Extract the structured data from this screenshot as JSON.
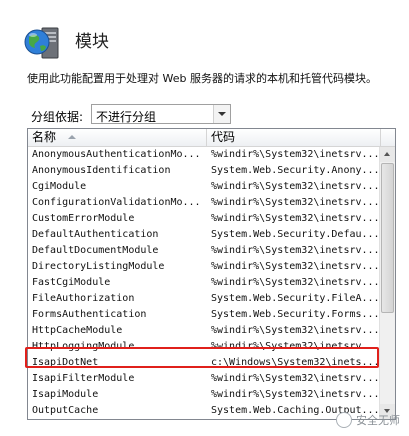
{
  "header": {
    "title": "模块",
    "icon": "globe-server-icon"
  },
  "description": "使用此功能配置用于处理对 Web 服务器的请求的本机和托管代码模块。",
  "grouping": {
    "label": "分组依据:",
    "value": "不进行分组"
  },
  "table": {
    "columns": [
      "名称",
      "代码"
    ],
    "sort": "ascending",
    "rows": [
      {
        "name": "AnonymousAuthenticationMo...",
        "code": "%windir%\\System32\\inetsrv..."
      },
      {
        "name": "AnonymousIdentification",
        "code": "System.Web.Security.Anony..."
      },
      {
        "name": "CgiModule",
        "code": "%windir%\\System32\\inetsrv..."
      },
      {
        "name": "ConfigurationValidationMo...",
        "code": "%windir%\\System32\\inetsrv..."
      },
      {
        "name": "CustomErrorModule",
        "code": "%windir%\\System32\\inetsrv..."
      },
      {
        "name": "DefaultAuthentication",
        "code": "System.Web.Security.Defau..."
      },
      {
        "name": "DefaultDocumentModule",
        "code": "%windir%\\System32\\inetsrv..."
      },
      {
        "name": "DirectoryListingModule",
        "code": "%windir%\\System32\\inetsrv..."
      },
      {
        "name": "FastCgiModule",
        "code": "%windir%\\System32\\inetsrv..."
      },
      {
        "name": "FileAuthorization",
        "code": "System.Web.Security.FileA..."
      },
      {
        "name": "FormsAuthentication",
        "code": "System.Web.Security.Forms..."
      },
      {
        "name": "HttpCacheModule",
        "code": "%windir%\\System32\\inetsrv..."
      },
      {
        "name": "HttpLoggingModule",
        "code": "%windir%\\System32\\inetsrv..."
      },
      {
        "name": "IsapiDotNet",
        "code": "c:\\Windows\\System32\\inets..."
      },
      {
        "name": "IsapiFilterModule",
        "code": "%windir%\\System32\\inetsrv..."
      },
      {
        "name": "IsapiModule",
        "code": "%windir%\\System32\\inetsrv..."
      },
      {
        "name": "OutputCache",
        "code": "System.Web.Caching.Output..."
      }
    ],
    "highlighted_row": "IsapiDotNet",
    "highlight_color": "#e0201b"
  },
  "watermark": {
    "text": "安全无师",
    "icon": "logo-icon"
  }
}
